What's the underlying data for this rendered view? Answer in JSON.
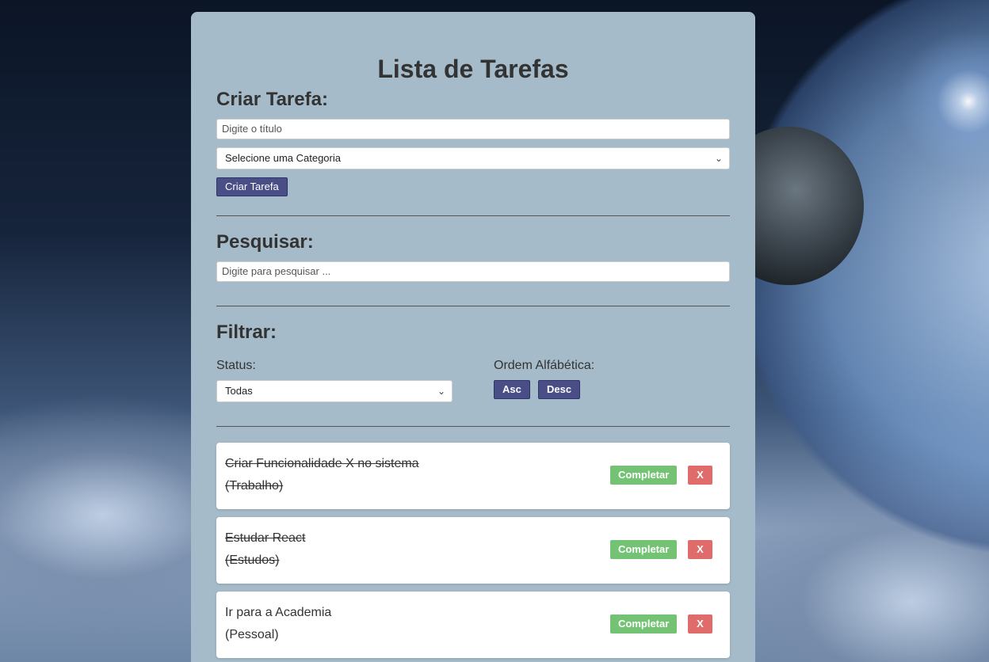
{
  "app": {
    "title": "Lista de Tarefas"
  },
  "create": {
    "heading": "Criar Tarefa:",
    "title_placeholder": "Digite o título",
    "category_selected": "Selecione uma Categoria",
    "submit_label": "Criar Tarefa"
  },
  "search": {
    "heading": "Pesquisar:",
    "placeholder": "Digite para pesquisar ..."
  },
  "filter": {
    "heading": "Filtrar:",
    "status_label": "Status:",
    "status_selected": "Todas",
    "order_label": "Ordem Alfábética:",
    "asc_label": "Asc",
    "desc_label": "Desc"
  },
  "tasks": [
    {
      "title": "Criar Funcionalidade X no sistema",
      "category": "(Trabalho)",
      "completed": true,
      "complete_label": "Completar",
      "remove_label": "X"
    },
    {
      "title": "Estudar React",
      "category": "(Estudos)",
      "completed": true,
      "complete_label": "Completar",
      "remove_label": "X"
    },
    {
      "title": "Ir para a Academia",
      "category": "(Pessoal)",
      "completed": false,
      "complete_label": "Completar",
      "remove_label": "X"
    }
  ],
  "colors": {
    "panel": "#a5bbc9",
    "primary_button": "#4a4e86",
    "complete_button": "#5cb85c",
    "remove_button": "#e06b6b"
  },
  "icons": {
    "select_chevron": "chevron-down-icon"
  }
}
